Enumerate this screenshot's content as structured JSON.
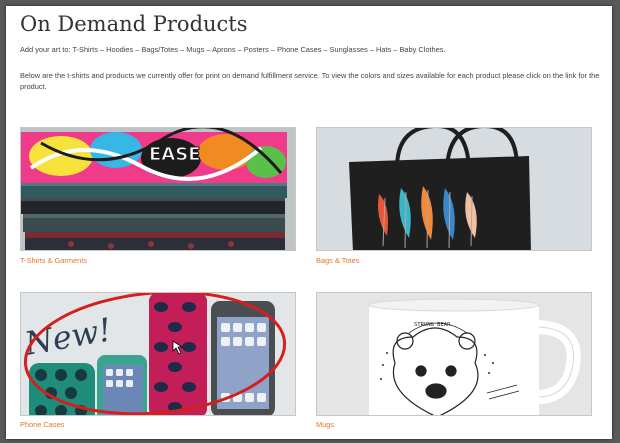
{
  "page": {
    "title": "On Demand Products",
    "intro": "Add your art to: T-Shirts – Hoodies – Bags/Totes – Mugs – Aprons – Posters – Phone Cases – Sunglasses – Hats – Baby Clothes.",
    "description": "Below are the t-shirts and products we currently offer for print on demand fulfillment service. To view the colors and sizes available for each product please click on the link for the product."
  },
  "products": [
    {
      "label": "T-Shirts & Garments",
      "image": "folded-shirts-stack"
    },
    {
      "label": "Bags & Totes",
      "image": "black-tote-with-feathers"
    },
    {
      "label": "Phone Cases",
      "image": "phone-cases-new",
      "overlay_text": "New!"
    },
    {
      "label": "Mugs",
      "image": "white-mug-bear",
      "overlay_text": "STRONG BEAR"
    }
  ],
  "colors": {
    "link": "#e4762a",
    "annotation": "#d41f1f"
  }
}
